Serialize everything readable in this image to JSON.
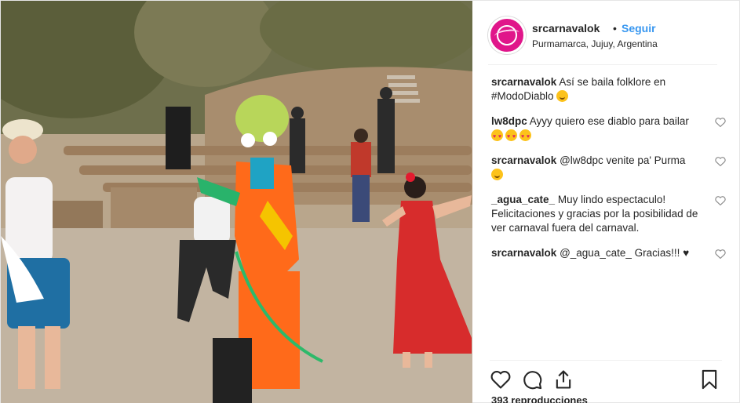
{
  "post": {
    "username": "srcarnavalok",
    "separator": "•",
    "follow_label": "Seguir",
    "location": "Purmamarca, Jujuy, Argentina",
    "views": "393 reproducciones"
  },
  "comments": [
    {
      "user": "srcarnavalok",
      "text": "Así se baila folklore en #ModoDiablo",
      "emoji": [
        "yum"
      ],
      "likeable": false
    },
    {
      "user": "lw8dpc",
      "text": "Ayyy quiero ese diablo para bailar",
      "emoji": [
        "heart-eyes",
        "heart-eyes",
        "heart-eyes"
      ],
      "likeable": true
    },
    {
      "user": "srcarnavalok",
      "text": "@lw8dpc venite pa' Purma",
      "emoji": [
        "yum"
      ],
      "likeable": true
    },
    {
      "user": "_agua_cate_",
      "text": "Muy lindo espectaculo! Felicitaciones y gracias por la posibilidad de ver carnaval fuera del carnaval.",
      "emoji": [],
      "likeable": true
    },
    {
      "user": "srcarnavalok",
      "text": "@_agua_cate_ Gracias!!! ♥",
      "emoji": [],
      "likeable": true
    }
  ],
  "icons": {
    "like": "heart-outline-icon",
    "comment": "speech-bubble-icon",
    "share": "share-icon",
    "save": "bookmark-icon"
  },
  "colors": {
    "follow": "#3897f0",
    "avatar": "#e0168a",
    "dancer_costume": "#ff6a1a",
    "dress": "#d72c2c"
  }
}
